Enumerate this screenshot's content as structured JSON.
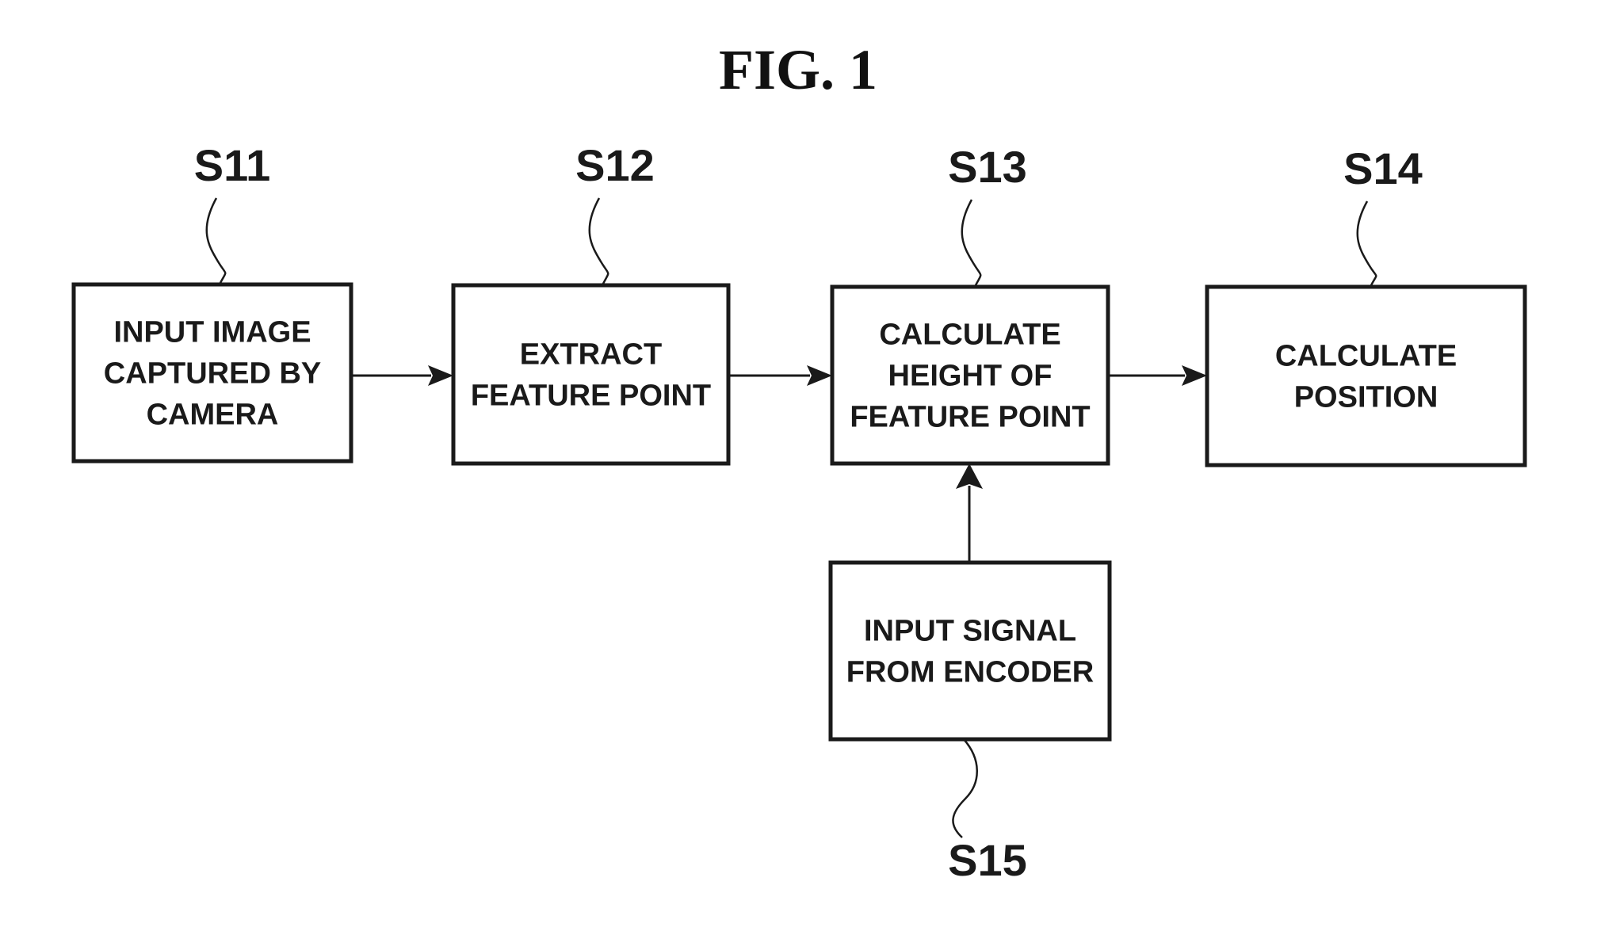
{
  "figure": {
    "title": "FIG. 1"
  },
  "steps": [
    {
      "id": "S11",
      "label": "S11",
      "lines": [
        "INPUT IMAGE",
        "CAPTURED BY",
        "CAMERA"
      ]
    },
    {
      "id": "S12",
      "label": "S12",
      "lines": [
        "EXTRACT",
        "FEATURE POINT"
      ]
    },
    {
      "id": "S13",
      "label": "S13",
      "lines": [
        "CALCULATE",
        "HEIGHT OF",
        "FEATURE POINT"
      ]
    },
    {
      "id": "S14",
      "label": "S14",
      "lines": [
        "CALCULATE",
        "POSITION"
      ]
    },
    {
      "id": "S15",
      "label": "S15",
      "lines": [
        "INPUT SIGNAL",
        "FROM ENCODER"
      ]
    }
  ],
  "connections": [
    {
      "from": "S11",
      "to": "S12"
    },
    {
      "from": "S12",
      "to": "S13"
    },
    {
      "from": "S13",
      "to": "S14"
    },
    {
      "from": "S15",
      "to": "S13"
    }
  ]
}
